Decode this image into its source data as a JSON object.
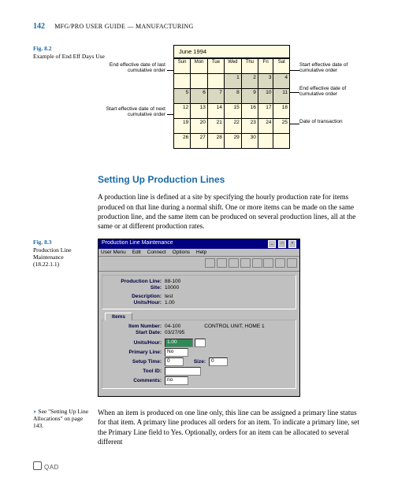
{
  "header": {
    "page_num": "142",
    "title_prefix": "MFG/PRO U",
    "title_mid1": "SER",
    "title_mid2": " G",
    "title_mid3": "UIDE",
    "title_dash": " — M",
    "title_suffix": "ANUFACTURING"
  },
  "fig82": {
    "label": "Fig. 8.2",
    "caption": "Example of End Eff Days Use",
    "month": "June 1994",
    "weekdays": [
      "Sun",
      "Mon",
      "Tue",
      "Wed",
      "Thu",
      "Fri",
      "Sat"
    ],
    "callouts": {
      "c1": "End effective date of last cumulative order",
      "c2": "Start effective date of next cumulative order",
      "c3": "Start effective date of cumulative order",
      "c4": "End effective date of cumulative order",
      "c5": "Date of transaction"
    }
  },
  "section": {
    "heading": "Setting Up Production Lines",
    "para1": "A production line is defined at a site by specifying the hourly production rate for items produced on that line during a normal shift. One or more items can be made on the same production line, and the same item can be produced on several production lines, all at the same or at different production rates."
  },
  "fig83": {
    "label": "Fig. 8.3",
    "caption1": "Production Line",
    "caption2": "Maintenance",
    "caption3": "(18.22.1.1)",
    "win_title": "Production Line Maintenance",
    "menu": [
      "User Menu",
      "Edit",
      "Connect",
      "Options",
      "Help"
    ],
    "fields": {
      "prod_line_lbl": "Production Line:",
      "prod_line_val": "88-100",
      "site_lbl": "Site:",
      "site_val": "10000",
      "desc_lbl": "Description:",
      "desc_val": "test",
      "uph_lbl": "Units/Hour:",
      "uph_val": "1.00",
      "items_tab": "Items",
      "item_lbl": "Item Number:",
      "item_val": "04-100",
      "item_desc": "CONTROL UNIT, HOME 1",
      "start_lbl": "Start Date:",
      "start_val": "03/27/95",
      "uph2_lbl": "Units/Hour:",
      "uph2_val": "1.00",
      "primary_lbl": "Primary Line:",
      "primary_val": "No",
      "setup_lbl": "Setup Time:",
      "setup_val": "0",
      "setup_size_lbl": "Size:",
      "setup_size_val": "0",
      "tool_lbl": "Tool ID:",
      "comments_lbl": "Comments:",
      "comments_val": "no"
    }
  },
  "margin_note": {
    "text": "See \"Setting Up Line Allocations\" on page 143."
  },
  "bottom_para": "When an item is produced on one line only, this line can be assigned a primary line status for that item. A primary line produces all orders for an item. To indicate a primary line, set the Primary Line field to Yes. Optionally, orders for an item can be allocated to several different",
  "footer": {
    "brand": "QAD"
  }
}
